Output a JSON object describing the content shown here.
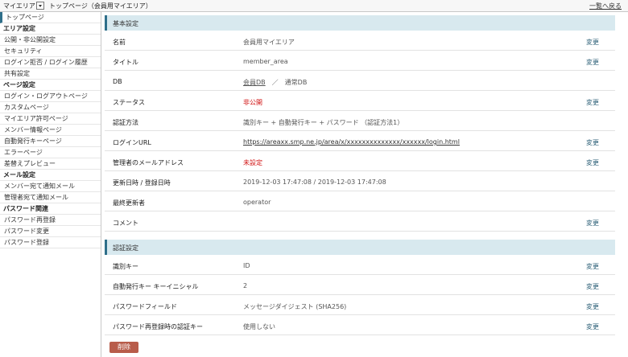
{
  "topbar": {
    "app_title": "マイエリア",
    "page_title": "トップページ（会員用マイエリア）",
    "back_link": "一覧へ戻る"
  },
  "sidebar": {
    "top_item": "トップページ",
    "area_heading": "エリア設定",
    "area_items": [
      "公開・非公開設定",
      "セキュリティ",
      "ログイン拒否 / ログイン履歴",
      "共有設定"
    ],
    "page_heading": "ページ設定",
    "page_items": [
      "ログイン・ログアウトページ",
      "カスタムページ",
      "マイエリア許可ページ",
      "メンバー情報ページ",
      "自動発行キーページ",
      "エラーページ",
      "差替えプレビュー"
    ],
    "mail_heading": "メール設定",
    "mail_items": [
      "メンバー宛て通知メール",
      "管理者宛て通知メール"
    ],
    "password_heading": "パスワード関連",
    "password_items": [
      "パスワード再登録",
      "パスワード変更",
      "パスワード登録"
    ]
  },
  "basic": {
    "heading": "基本設定",
    "change_label": "変更",
    "rows": {
      "name": {
        "label": "名前",
        "value": "会員用マイエリア"
      },
      "title": {
        "label": "タイトル",
        "value": "member_area"
      },
      "db": {
        "label": "DB",
        "value1": "会員DB",
        "sep": "／",
        "value2": "通常DB"
      },
      "status": {
        "label": "ステータス",
        "value": "非公開"
      },
      "auth": {
        "label": "認証方法",
        "value": "識別キー + 自動発行キー + パスワード （認証方法1）"
      },
      "login_url": {
        "label": "ログインURL",
        "value": "https://areaxx.smp.ne.jp/area/x/xxxxxxxxxxxxxx/xxxxxx/login.html"
      },
      "admin_mail": {
        "label": "管理者のメールアドレス",
        "value": "未設定"
      },
      "dates": {
        "label": "更新日時 / 登録日時",
        "value": "2019-12-03 17:47:08 / 2019-12-03 17:47:08"
      },
      "updater": {
        "label": "最終更新者",
        "value": "operator"
      },
      "comment": {
        "label": "コメント",
        "value": ""
      }
    }
  },
  "auth_settings": {
    "heading": "認証設定",
    "rows": {
      "key": {
        "label": "識別キー",
        "value": "ID"
      },
      "initial": {
        "label": "自動発行キー キーイニシャル",
        "value": "2"
      },
      "pw_field": {
        "label": "パスワードフィールド",
        "value": "メッセージダイジェスト (SHA256)"
      },
      "reauth": {
        "label": "パスワード再登録時の認証キー",
        "value": "使用しない"
      }
    }
  },
  "actions": {
    "delete": "削除"
  }
}
